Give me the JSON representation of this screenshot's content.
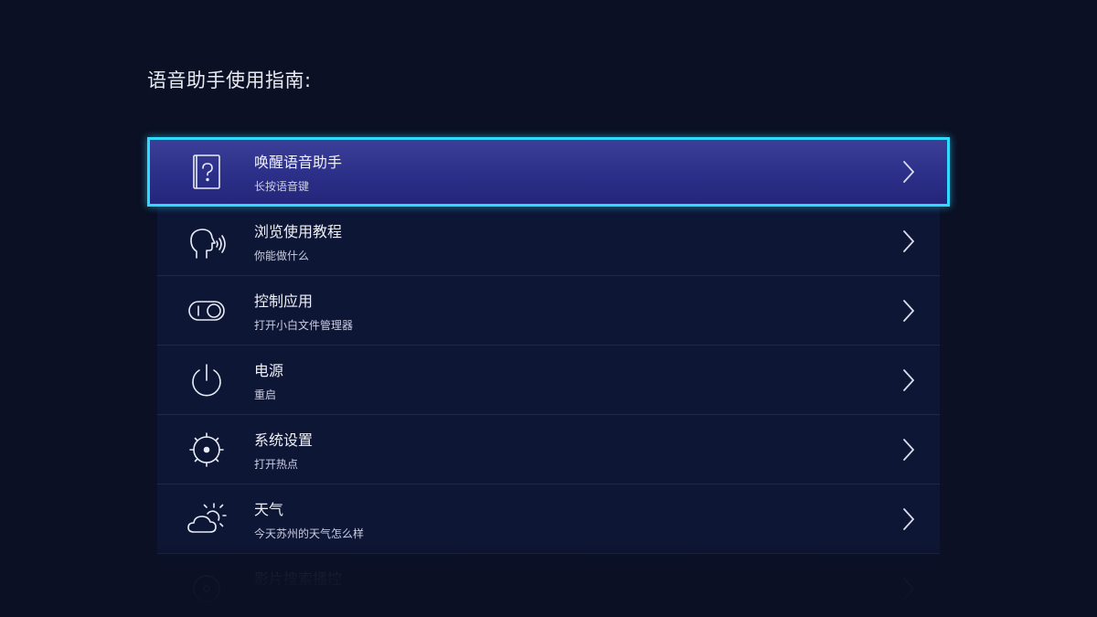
{
  "page": {
    "title": "语音助手使用指南:"
  },
  "theme": {
    "background": "#0b1024",
    "item_background": "#0e1636",
    "focus_border": "#2fd9ff",
    "focus_fill": "#2c2f88"
  },
  "items": [
    {
      "title": "唤醒语音助手",
      "subtitle": "长按语音键",
      "icon": "help-book-icon",
      "focused": true
    },
    {
      "title": "浏览使用教程",
      "subtitle": "你能做什么",
      "icon": "speaking-head-icon",
      "focused": false
    },
    {
      "title": "控制应用",
      "subtitle": "打开小白文件管理器",
      "icon": "toggle-switch-icon",
      "focused": false
    },
    {
      "title": "电源",
      "subtitle": "重启",
      "icon": "power-icon",
      "focused": false
    },
    {
      "title": "系统设置",
      "subtitle": "打开热点",
      "icon": "settings-gear-icon",
      "focused": false
    },
    {
      "title": "天气",
      "subtitle": "今天苏州的天气怎么样",
      "icon": "weather-cloud-sun-icon",
      "focused": false
    },
    {
      "title": "影片搜索播控",
      "subtitle": "",
      "icon": "film-icon",
      "focused": false
    }
  ]
}
